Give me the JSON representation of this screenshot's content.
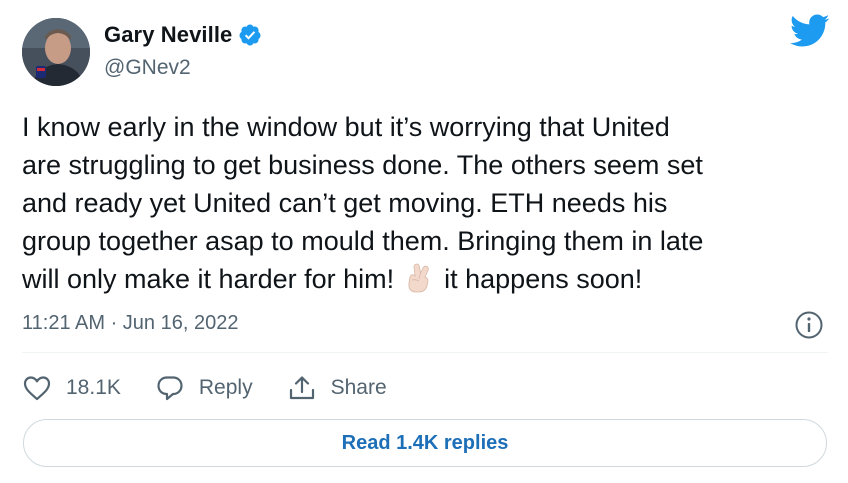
{
  "author": {
    "display_name": "Gary Neville",
    "handle": "@GNev2",
    "verified": true,
    "avatar_icon": "profile-photo-avatar"
  },
  "brand": {
    "logo_icon": "twitter-bird-icon",
    "accent_color": "#1d9bf0"
  },
  "tweet": {
    "lines": [
      "I know early in the window but it’s worrying that United",
      "are struggling to get business done. The others seem set",
      "and ready yet United can’t get moving. ETH needs his",
      "group together asap to mould them. Bringing them in late"
    ],
    "last_line_before_emoji": "will only make it harder for him!",
    "emoji_icon": "crossed-fingers-emoji",
    "last_line_after_emoji": "it happens soon!",
    "timestamp": "11:21 AM · Jun 16, 2022"
  },
  "actions": {
    "like_count": "18.1K",
    "reply_label": "Reply",
    "share_label": "Share"
  },
  "replies_button_label": "Read 1.4K replies",
  "colors": {
    "text_primary": "#0f1419",
    "text_secondary": "#536471",
    "link_blue": "#1d6fb8",
    "border": "#cfd9de"
  }
}
